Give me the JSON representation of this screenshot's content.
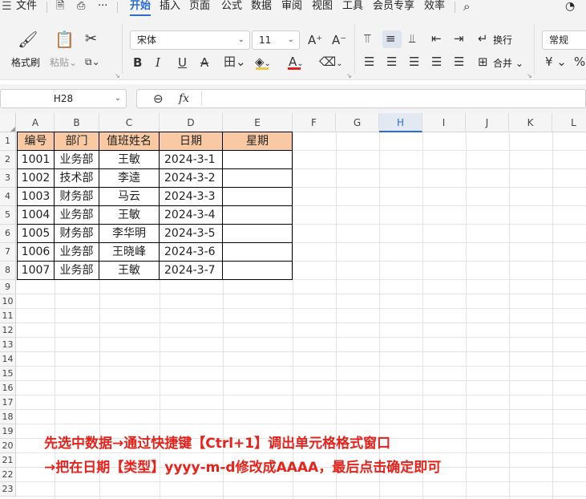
{
  "menubar": {
    "file": "文件",
    "more": "···",
    "tabs": [
      "开始",
      "插入",
      "页面",
      "公式",
      "数据",
      "审阅",
      "视图",
      "工具",
      "会员专享",
      "效率"
    ]
  },
  "ribbon": {
    "format_painter": "格式刷",
    "paste": "粘贴",
    "font_name": "宋体",
    "font_size": "11",
    "wrap_text": "换行",
    "merge": "合并",
    "number_format": "常规",
    "font_color": "#e8221a",
    "fill_color": "#f5c242"
  },
  "formula_bar": {
    "cell_ref": "H28",
    "fx_label": "fx",
    "formula": ""
  },
  "grid": {
    "columns": [
      "A",
      "B",
      "C",
      "D",
      "E",
      "F",
      "G",
      "H",
      "I",
      "J",
      "K",
      "L"
    ],
    "selected_column": "H",
    "rows": [
      "1",
      "2",
      "3",
      "4",
      "5",
      "6",
      "7",
      "8",
      "9",
      "10",
      "11",
      "12",
      "13",
      "14",
      "15",
      "16",
      "17",
      "18",
      "19",
      "20",
      "21",
      "22",
      "23"
    ]
  },
  "table": {
    "headers": [
      "编号",
      "部门",
      "值班姓名",
      "日期",
      "星期"
    ],
    "rows": [
      [
        "1001",
        "业务部",
        "王敏",
        "2024-3-1",
        ""
      ],
      [
        "1002",
        "技术部",
        "李逵",
        "2024-3-2",
        ""
      ],
      [
        "1003",
        "财务部",
        "马云",
        "2024-3-3",
        ""
      ],
      [
        "1004",
        "业务部",
        "王敏",
        "2024-3-4",
        ""
      ],
      [
        "1005",
        "财务部",
        "李华明",
        "2024-3-5",
        ""
      ],
      [
        "1006",
        "业务部",
        "王晓峰",
        "2024-3-6",
        ""
      ],
      [
        "1007",
        "业务部",
        "王敏",
        "2024-3-7",
        ""
      ]
    ],
    "header_fill": "#f8c9a2"
  },
  "instructions": [
    "先选中数据→通过快捷键【Ctrl+1】调出单元格格式窗口",
    "→把在日期【类型】yyyy-m-d修改成AAAA，最后点击确定即可"
  ]
}
